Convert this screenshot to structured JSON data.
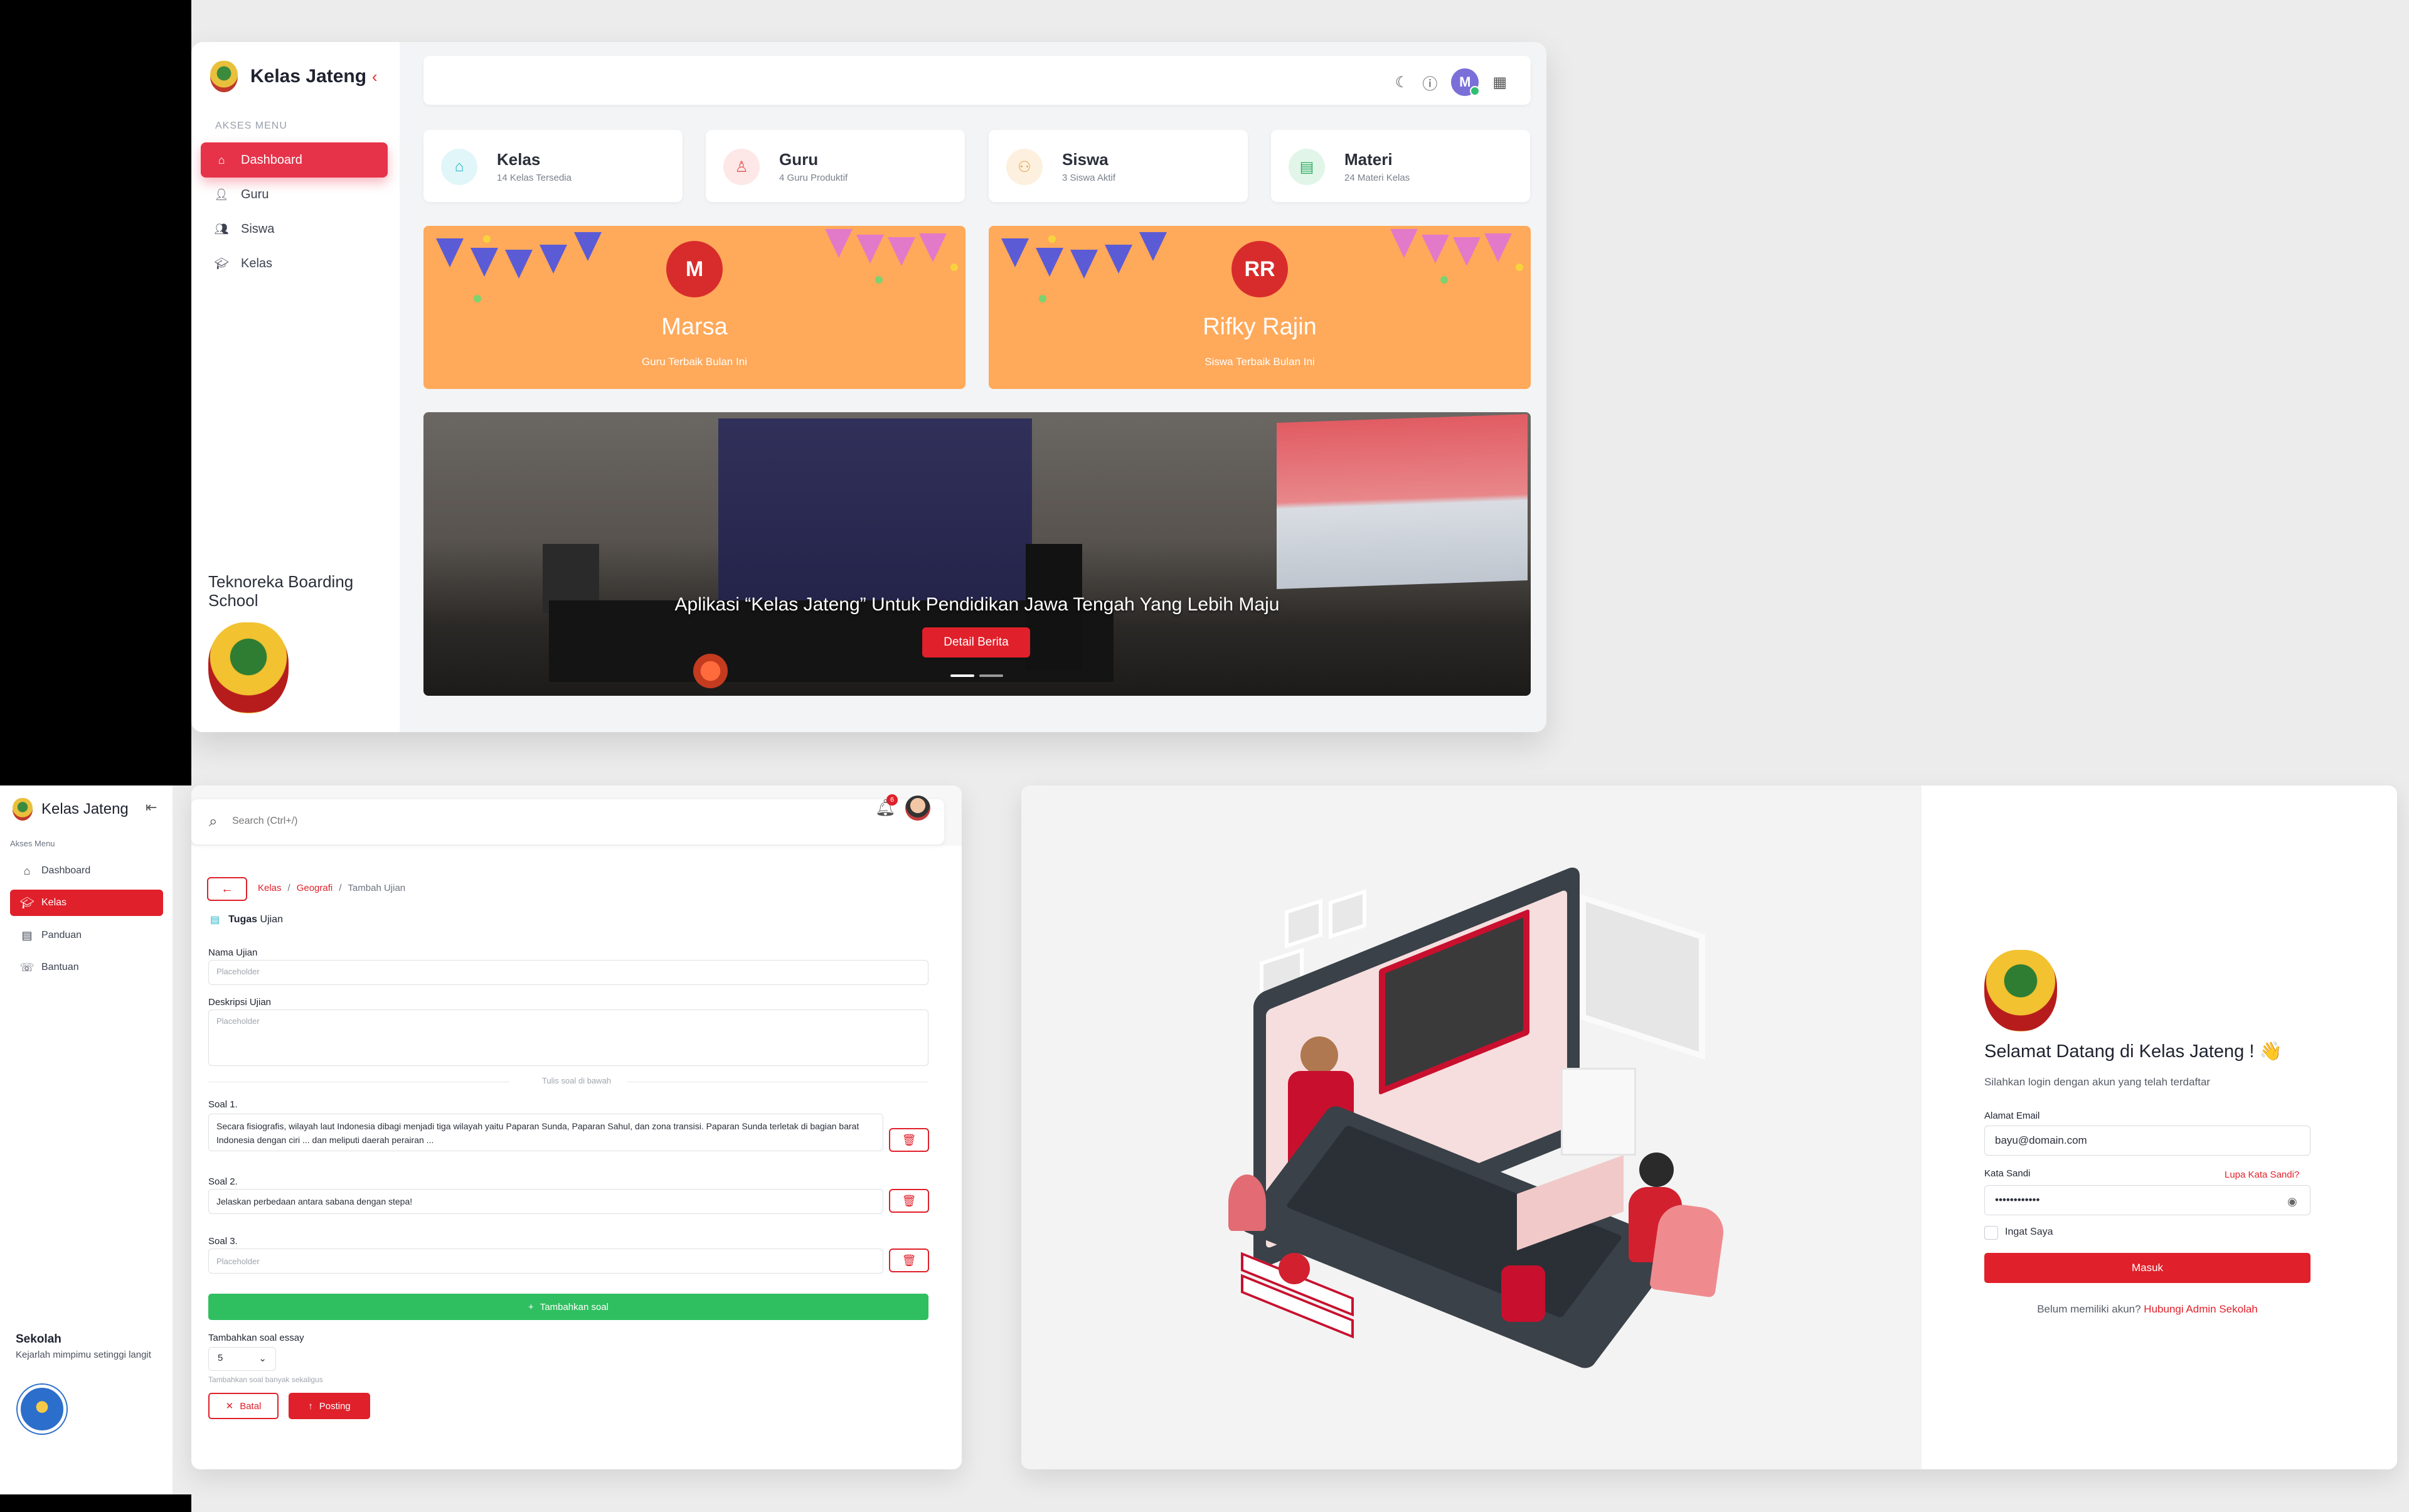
{
  "dashboard": {
    "app_title": "Kelas Jateng",
    "menu_caption": "AKSES MENU",
    "menu": [
      {
        "label": "Dashboard",
        "icon": "home-icon",
        "active": true
      },
      {
        "label": "Guru",
        "icon": "user-icon"
      },
      {
        "label": "Siswa",
        "icon": "users-icon"
      },
      {
        "label": "Kelas",
        "icon": "graduation-cap-icon"
      }
    ],
    "school_name": "Teknoreka Boarding School",
    "topbar_icons": [
      "moon-icon",
      "help-icon",
      "avatar",
      "qr-icon"
    ],
    "avatar_initial": "M",
    "stats": [
      {
        "title": "Kelas",
        "sub": "14 Kelas Tersedia",
        "icon": "home-icon",
        "color": "#1fb6c9",
        "bg": "#e1f6f9"
      },
      {
        "title": "Guru",
        "sub": "4 Guru Produktif",
        "icon": "user-icon",
        "color": "#e65b5b",
        "bg": "#fde7e7"
      },
      {
        "title": "Siswa",
        "sub": "3 Siswa Aktif",
        "icon": "users-icon",
        "color": "#e8a24a",
        "bg": "#fdf0df"
      },
      {
        "title": "Materi",
        "sub": "24 Materi Kelas",
        "icon": "book-icon",
        "color": "#2fae62",
        "bg": "#e1f5e9"
      }
    ],
    "awards": [
      {
        "initials": "M",
        "name": "Marsa",
        "role": "Guru Terbaik Bulan Ini"
      },
      {
        "initials": "RR",
        "name": "Rifky Rajin",
        "role": "Siswa Terbaik Bulan Ini"
      }
    ],
    "banner": {
      "caption": "Aplikasi “Kelas Jateng” Untuk Pendidikan Jawa Tengah Yang Lebih Maju",
      "button": "Detail Berita"
    }
  },
  "ujian": {
    "app_title": "Kelas Jateng",
    "menu_caption": "Akses Menu",
    "menu": [
      {
        "label": "Dashboard",
        "icon": "home-icon"
      },
      {
        "label": "Kelas",
        "icon": "graduation-cap-icon",
        "active": true
      },
      {
        "label": "Panduan",
        "icon": "book-icon"
      },
      {
        "label": "Bantuan",
        "icon": "phone-icon"
      }
    ],
    "school_title": "Sekolah",
    "school_sub": "Kejarlah mimpimu setinggi langit",
    "search_placeholder": "Search (Ctrl+/)",
    "notif_count": "6",
    "breadcrumb": [
      "Kelas",
      "Geografi",
      "Tambah Ujian"
    ],
    "section_title_bold": "Tugas",
    "section_title_rest": "Ujian",
    "nama_label": "Nama Ujian",
    "nama_placeholder": "Placeholder",
    "deskripsi_label": "Deskripsi Ujian",
    "deskripsi_placeholder": "Placeholder",
    "divider": "Tulis soal di bawah",
    "questions": [
      {
        "label": "Soal 1.",
        "text": "Secara fisiografis, wilayah laut Indonesia dibagi menjadi tiga wilayah yaitu Paparan Sunda, Paparan Sahul, dan zona transisi. Paparan Sunda terletak di bagian barat Indonesia dengan ciri ... dan meliputi daerah perairan ..."
      },
      {
        "label": "Soal 2.",
        "text": "Jelaskan perbedaan antara sabana dengan stepa!"
      },
      {
        "label": "Soal 3.",
        "text": "",
        "placeholder": "Placeholder"
      }
    ],
    "add_button": "Tambahkan soal",
    "add_essay_label": "Tambahkan soal essay",
    "add_essay_value": "5",
    "add_essay_hint": "Tambahkan soal banyak sekaligus",
    "cancel": "Batal",
    "post": "Posting"
  },
  "login": {
    "welcome": "Selamat Datang di Kelas Jateng ! 👋",
    "sub": "Silahkan login dengan akun yang telah terdaftar",
    "email_label": "Alamat Email",
    "email_value": "bayu@domain.com",
    "password_label": "Kata Sandi",
    "forgot": "Lupa Kata Sandi?",
    "password_value": "••••••••••••",
    "remember": "Ingat Saya",
    "submit": "Masuk",
    "no_account": "Belum memiliki akun?",
    "contact_admin": "Hubungi Admin Sekolah"
  }
}
